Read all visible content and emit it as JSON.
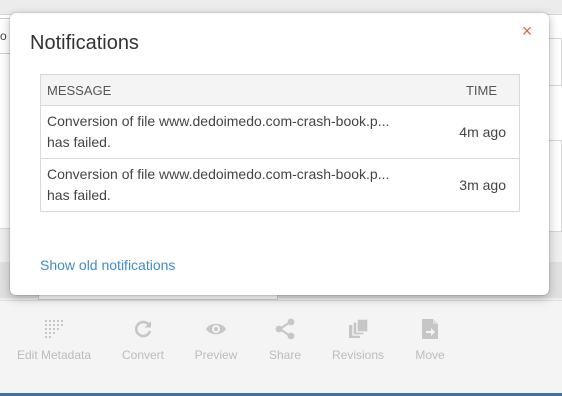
{
  "background": {
    "search_fragment": "o",
    "toolbar": [
      {
        "label": "Edit Metadata",
        "icon": "grid-icon"
      },
      {
        "label": "Convert",
        "icon": "refresh-icon"
      },
      {
        "label": "Preview",
        "icon": "eye-icon"
      },
      {
        "label": "Share",
        "icon": "share-icon"
      },
      {
        "label": "Revisions",
        "icon": "copy-icon"
      },
      {
        "label": "Move",
        "icon": "move-file-icon"
      }
    ]
  },
  "modal": {
    "title": "Notifications",
    "close_label": "×",
    "table": {
      "headers": {
        "message": "MESSAGE",
        "time": "TIME"
      },
      "rows": [
        {
          "message_line1": "Conversion of file www.dedoimedo.com-crash-book.p...",
          "message_line2": "has failed.",
          "time": "4m ago"
        },
        {
          "message_line1": "Conversion of file www.dedoimedo.com-crash-book.p...",
          "message_line2": "has failed.",
          "time": "3m ago"
        }
      ]
    },
    "show_old_label": "Show old notifications"
  },
  "colors": {
    "accent_link": "#3f8cc4",
    "close": "#e0674c",
    "bottom_bar": "#3d73a9"
  }
}
